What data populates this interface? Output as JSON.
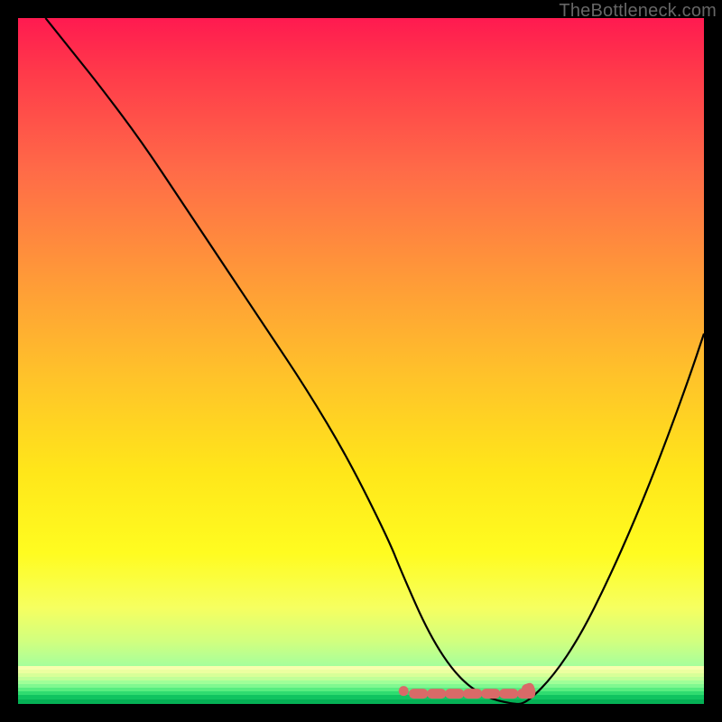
{
  "attribution": "TheBottleneck.com",
  "colors": {
    "curve": "#000000",
    "optimal_marker": "#d96a68",
    "background_black": "#000000"
  },
  "chart_data": {
    "type": "line",
    "title": "",
    "xlabel": "",
    "ylabel": "",
    "xlim": [
      0,
      100
    ],
    "ylim": [
      0,
      100
    ],
    "series": [
      {
        "name": "bottleneck-curve",
        "x": [
          4,
          8,
          12,
          18,
          24,
          30,
          36,
          42,
          48,
          54,
          56,
          60,
          64,
          68,
          72,
          74,
          78,
          82,
          86,
          90,
          94,
          98,
          100
        ],
        "y": [
          100,
          95,
          90,
          82,
          73,
          64,
          55,
          46,
          36,
          24,
          19,
          10,
          4,
          1,
          0,
          0,
          4,
          10,
          18,
          27,
          37,
          48,
          54
        ]
      }
    ],
    "annotations": [
      {
        "name": "optimal-range",
        "type": "segment",
        "x_start": 57,
        "x_end": 75,
        "y": 1.5
      }
    ]
  }
}
